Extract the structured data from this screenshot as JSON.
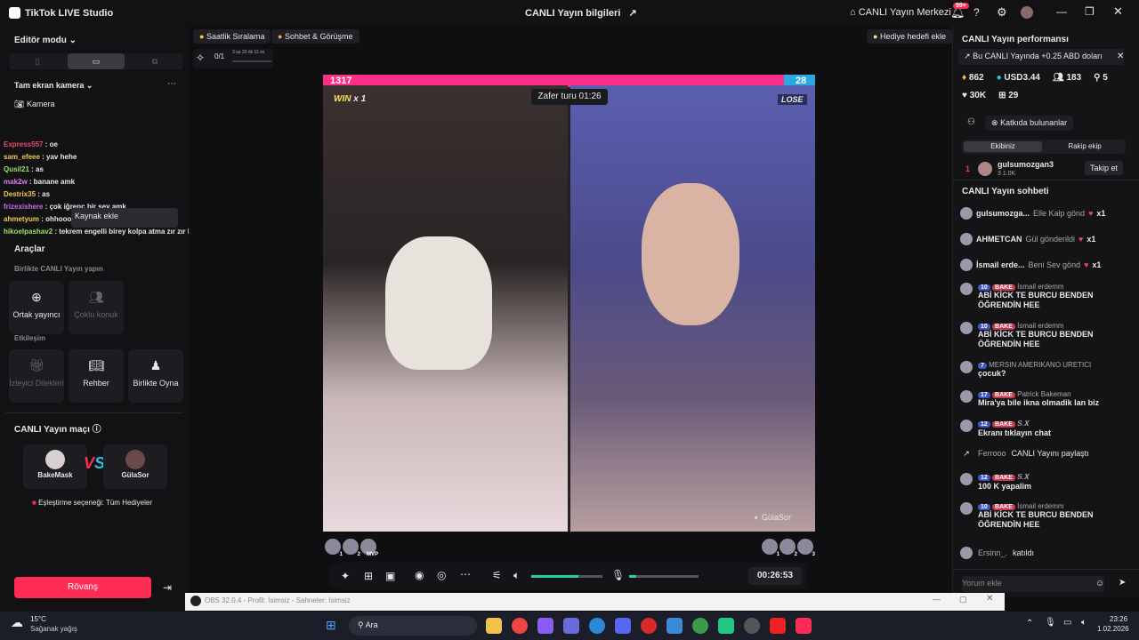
{
  "app": {
    "title": "TikTok LIVE Studio",
    "center_title": "CANLI Yayın bilgileri",
    "live_center": "CANLI Yayın Merkezi",
    "notif_count": "99+"
  },
  "left": {
    "editor_mode": "Editör modu",
    "camera_section": "Tam ekran kamera",
    "camera_item": "Kamera",
    "overlay_chat": [
      {
        "user": "Express557",
        "text": "oe",
        "color": "#e84a6b"
      },
      {
        "user": "sam_efeee",
        "text": "yav hehe",
        "color": "#f2c94c"
      },
      {
        "user": "Qusil21",
        "text": "as",
        "color": "#9be36b"
      },
      {
        "user": "mak2w",
        "text": "banane amk",
        "color": "#e07bf0"
      },
      {
        "user": "Destrix35",
        "text": "as",
        "color": "#f2c94c"
      },
      {
        "user": "frizexishere",
        "text": "çok iğrenç bir şey amk",
        "color": "#c86bf0"
      },
      {
        "user": "ahmetyum",
        "text": "ohhooo hadi",
        "color": "#f2c94c"
      },
      {
        "user": "hikoelpashav2",
        "text": "tekrem engelli birey kolpa atma zır zır heeeeee",
        "color": "#9be36b"
      }
    ],
    "tooltip": "Kaynak ekle",
    "tools_title": "Araçlar",
    "together_title": "Birlikte CANLI Yayın yapın",
    "cohost": "Ortak yayıncı",
    "multi_guest": "Çoklu konuk",
    "interaction_title": "Etkileşim",
    "viewer_wishes": "İzleyici Dilekleri",
    "guide": "Rehber",
    "play_together": "Birlikte Oyna",
    "match_title": "CANLI Yayın maçı",
    "player1": "BakeMask",
    "player2": "GülaSor",
    "matching": "Eşleştirme seçeneği: Tüm Hediyeler",
    "rematch": "Rövanş"
  },
  "center": {
    "chip_hourly": "Saatlik Sıralama",
    "chip_chat": "Sohbet & Görüşme",
    "gift_goal": "Hediye hedefi ekle",
    "goal_progress": "0/1",
    "goal_time": "3 sa 33 dk 11 sn",
    "score_left": "1317",
    "score_right": "28",
    "win": "WIN",
    "win_x": "x 1",
    "lose": "LOSE",
    "round": "Zafer turu 01:26",
    "right_name": "GülaSor",
    "timer": "00:26:53",
    "volume_level": 0.66,
    "mic_level": 0.1,
    "left_ranks": [
      "1",
      "2",
      "MVP"
    ],
    "right_ranks": [
      "1",
      "2",
      "3"
    ]
  },
  "right": {
    "perf_title": "CANLI Yayın performansı",
    "perf_banner": "Bu CANLI Yayında +0.25 ABD doları",
    "stats": {
      "likes": "862",
      "usd": "USD3.44",
      "viewers": "183",
      "v5": "5",
      "k30": "30K",
      "gifts": "29"
    },
    "contributors": "Katkıda bulunanlar",
    "tab_team": "Ekibiniz",
    "tab_rival": "Rakip ekip",
    "top_rank": "1",
    "top_user": "gulsumozgan3",
    "top_sub": "3  1.0K",
    "follow": "Takip et",
    "chat_title": "CANLI Yayın sohbeti",
    "gifts": [
      {
        "user": "gulsumozga...",
        "action": "Elle Kalp gönd",
        "count": "x1"
      },
      {
        "user": "AHMETCAN",
        "action": "Gül gönderildi",
        "count": "x1"
      },
      {
        "user": "İsmail erde...",
        "action": "Beni Sev gönd",
        "count": "x1"
      }
    ],
    "messages": [
      {
        "lvl": "10",
        "tag": "BAKE",
        "user": "İsmail erdemm",
        "text": "ABİ KİCK TE BURCU BENDEN ÖĞRENDİN HEE"
      },
      {
        "lvl": "10",
        "tag": "BAKE",
        "user": "İsmail erdemm",
        "text": "ABİ KİCK TE BURCU BENDEN ÖĞRENDİN HEE"
      },
      {
        "lvl": "7",
        "tag": "",
        "user": "MERSIN AMERIKANO URETICI",
        "text": "çocuk?"
      },
      {
        "lvl": "17",
        "tag": "BAKE",
        "user": "Patrick Bakeman",
        "text": "Mira'ya bile ikna olmadik lan biz"
      },
      {
        "lvl": "12",
        "tag": "BAKE",
        "user": "𝑺.𝑿",
        "text": "Ekranı tıklayın chat"
      }
    ],
    "share_user": "Ferrooo",
    "share_text": "CANLI Yayını paylaştı",
    "messages2": [
      {
        "lvl": "12",
        "tag": "BAKE",
        "user": "𝑺.𝑿",
        "text": "100 K yapalim"
      },
      {
        "lvl": "10",
        "tag": "BAKE",
        "user": "İsmail erdemm",
        "text": "ABİ KİCK TE BURCU BENDEN ÖĞRENDİN HEE"
      }
    ],
    "join_user": "Ersinn_.",
    "join_text": "katıldı",
    "comment_placeholder": "Yorum ekle"
  },
  "obs": {
    "title": "OBS 32.0.4 - Profil: İsimsiz - Sahneler: İsimsiz"
  },
  "taskbar": {
    "temp": "15°C",
    "weather": "Sağanak yağış",
    "search": "Ara",
    "time": "23:26",
    "date": "1.02.2026"
  },
  "colors": {
    "accent": "#fe2c55",
    "score_bar": "#ff2d86",
    "score_right": "#2aa8e0"
  }
}
